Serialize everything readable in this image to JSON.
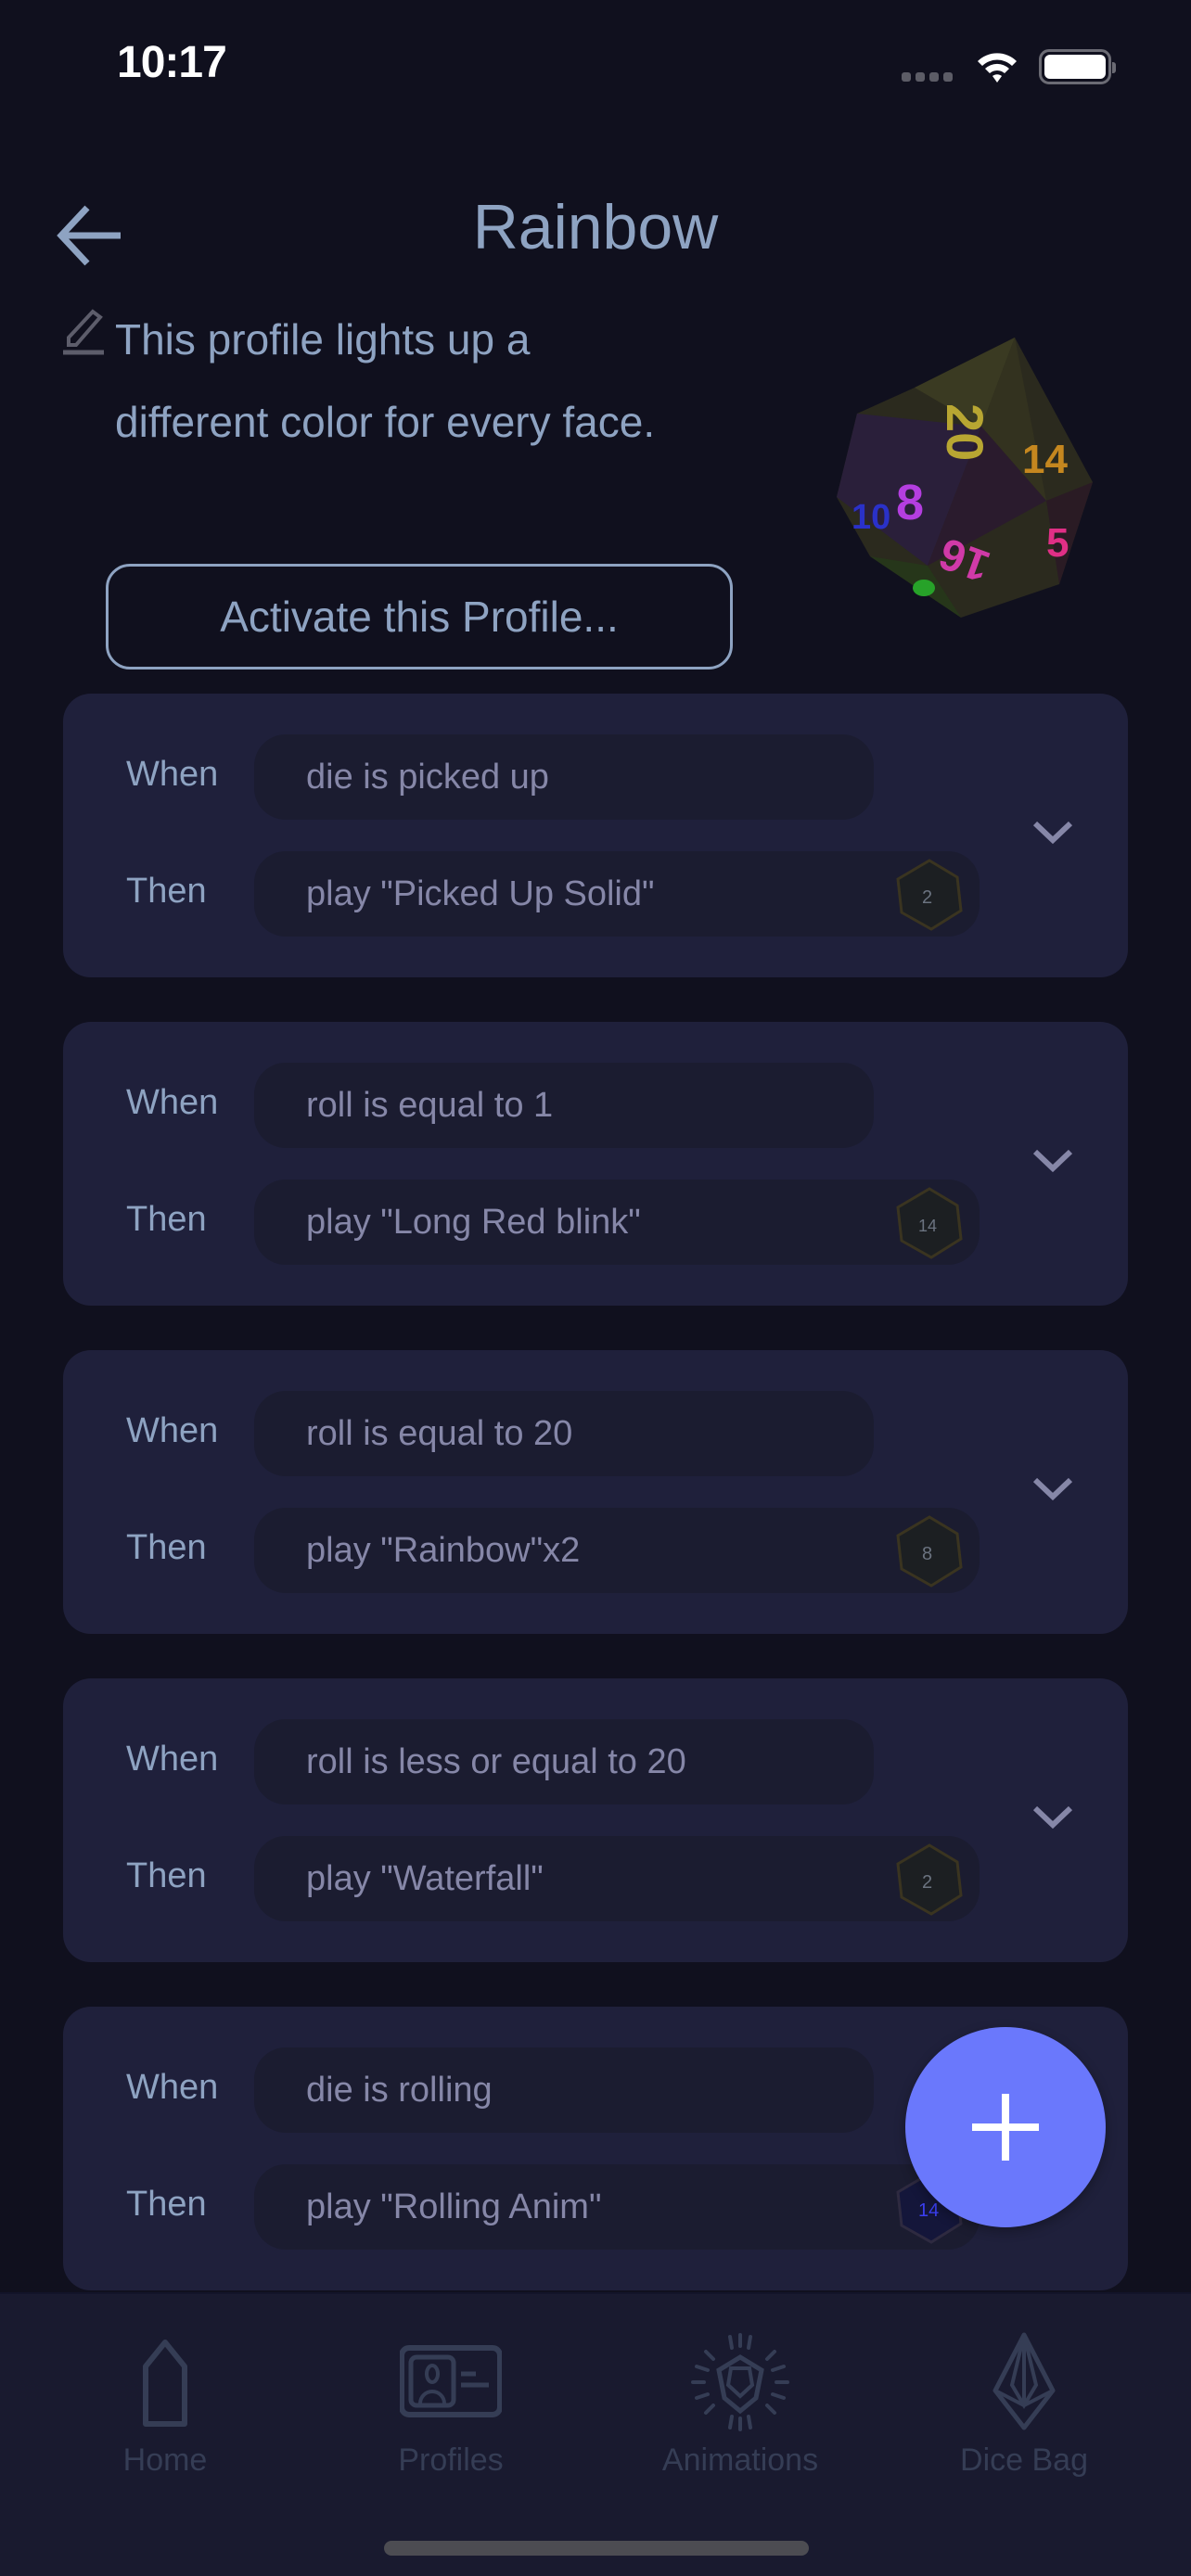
{
  "status_bar": {
    "time": "10:17",
    "icons": [
      "signal-icon",
      "wifi-icon",
      "battery-icon"
    ]
  },
  "header": {
    "title": "Rainbow",
    "back_icon": "arrow-left-icon"
  },
  "profile": {
    "description": "This profile lights up a different color for every face.",
    "edit_icon": "pencil-icon",
    "activate_label": "Activate this Profile...",
    "die_image": "d20-die-rainbow"
  },
  "rules": {
    "when_label": "When",
    "then_label": "Then",
    "items": [
      {
        "condition": "die is picked up",
        "action": "play \"Picked Up Solid\""
      },
      {
        "condition": "roll is equal to 1",
        "action": "play \"Long Red blink\""
      },
      {
        "condition": "roll is equal to 20",
        "action": "play \"Rainbow\"x2"
      },
      {
        "condition": "roll is less or equal to 20",
        "action": "play \"Waterfall\""
      },
      {
        "condition": "die is rolling",
        "action": "play \"Rolling Anim\""
      }
    ]
  },
  "fab": {
    "icon": "plus-icon",
    "color": "#6a78fc"
  },
  "tab_bar": {
    "tabs": [
      {
        "label": "Home",
        "icon": "home-icon"
      },
      {
        "label": "Profiles",
        "icon": "profile-card-icon"
      },
      {
        "label": "Animations",
        "icon": "animations-burst-icon"
      },
      {
        "label": "Dice Bag",
        "icon": "dice-gem-icon"
      }
    ]
  },
  "colors": {
    "background": "#10101e",
    "card": "#1f203b",
    "pill": "#1b1c30",
    "text_primary": "#8ea3c2",
    "text_secondary": "#8687a8",
    "accent": "#6a78fc",
    "tab_inactive": "#353d55"
  }
}
